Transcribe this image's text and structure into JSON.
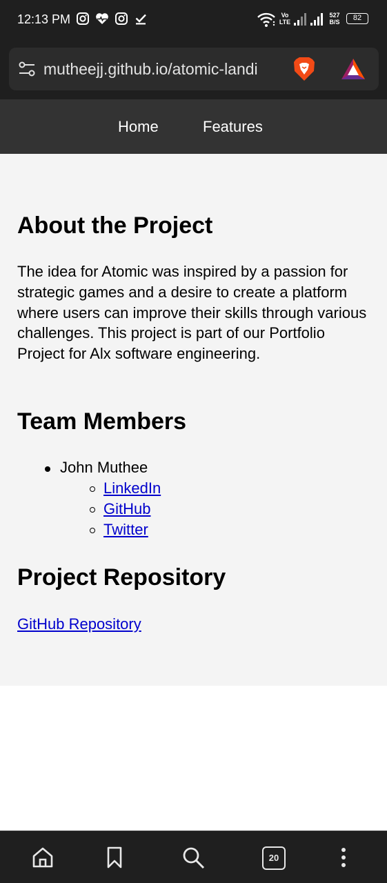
{
  "status_bar": {
    "time": "12:13 PM",
    "net_speed_value": "527",
    "net_speed_unit": "B/S",
    "volte_top": "Vo",
    "volte_bottom": "LTE",
    "battery": "82",
    "notification_icons": [
      "instagram-icon",
      "health-heart-icon",
      "instagram-icon",
      "download-done-icon"
    ]
  },
  "browser": {
    "url": "mutheejj.github.io/atomic-landi",
    "tab_count": "20",
    "colors": {
      "chrome_bg": "#1f1f1f",
      "url_box_bg": "#2c2c2c",
      "brave_orange": "#f24a16"
    }
  },
  "site_nav": {
    "items": [
      {
        "label": "Home"
      },
      {
        "label": "Features"
      }
    ]
  },
  "about": {
    "heading": "About the Project",
    "paragraph": "The idea for Atomic was inspired by a passion for strategic games and a desire to create a platform where users can improve their skills through various challenges. This project is part of our Portfolio Project for Alx software engineering."
  },
  "team": {
    "heading": "Team Members",
    "members": [
      {
        "name": "John Muthee",
        "links": [
          {
            "label": "LinkedIn"
          },
          {
            "label": "GitHub"
          },
          {
            "label": "Twitter"
          }
        ]
      }
    ]
  },
  "repository": {
    "heading": "Project Repository",
    "link_label": "GitHub Repository"
  },
  "colors": {
    "content_bg": "#f4f4f4",
    "nav_bg": "#333333",
    "link": "#0000cc"
  }
}
